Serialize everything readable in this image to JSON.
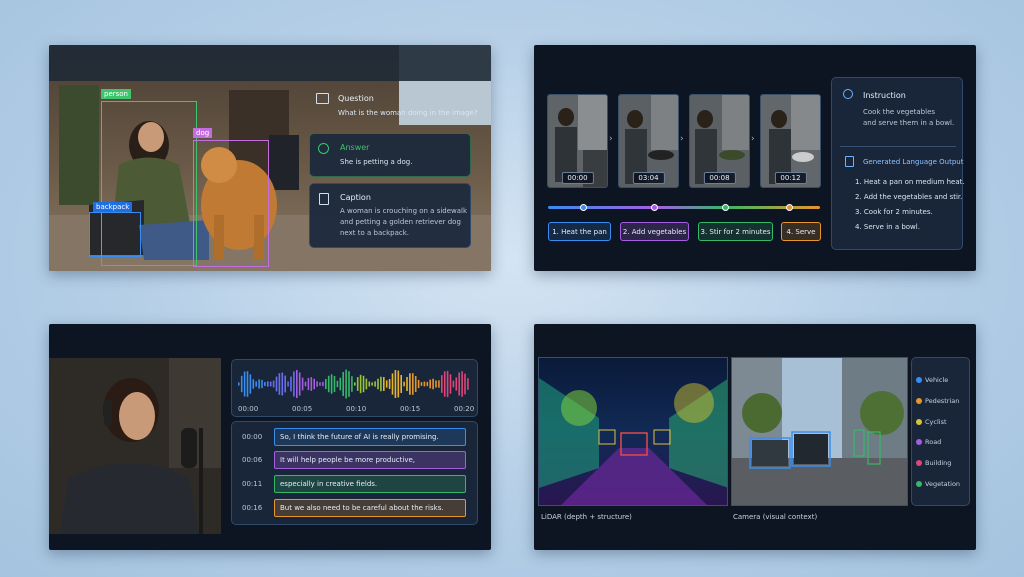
{
  "vqa": {
    "tags": {
      "person": "person",
      "dog": "dog",
      "backpack": "backpack"
    },
    "question": {
      "title": "Question",
      "text": "What is the woman doing in the image?",
      "icon": "image-icon"
    },
    "answer": {
      "title": "Answer",
      "text": "She is petting a dog.",
      "icon": "answer-icon"
    },
    "caption": {
      "title": "Caption",
      "text": "A woman is crouching on a sidewalk\nand petting a golden retriever dog\nnext to a backpack.",
      "icon": "document-icon"
    },
    "colors": {
      "person": "#3ec46d",
      "dog": "#c36ee0",
      "backpack": "#3a8df0",
      "answer": "#3ec46d"
    }
  },
  "video": {
    "timestamps": [
      "00:00",
      "03:04",
      "00:08",
      "00:12"
    ],
    "steps": [
      {
        "label": "1. Heat the pan",
        "color": "#3a8df0"
      },
      {
        "label": "2. Add vegetables",
        "color": "#a45ee0"
      },
      {
        "label": "3. Stir for 2 minutes",
        "color": "#35b86a"
      },
      {
        "label": "4. Serve",
        "color": "#e8952e"
      }
    ],
    "instruction": {
      "title": "Instruction",
      "text": "Cook the vegetables\nand serve them in a bowl."
    },
    "output": {
      "title": "Generated Language Output",
      "lines": [
        "1.  Heat a pan on medium heat.",
        "2.  Add the vegetables and stir.",
        "3.  Cook for 2 minutes.",
        "4.  Serve in a bowl."
      ]
    }
  },
  "audio": {
    "ticks": [
      "00:00",
      "00:05",
      "00:10",
      "00:15",
      "00:20"
    ],
    "transcript": [
      {
        "time": "00:00",
        "text": "So, I think the future of AI is really promising.",
        "color": "#3a8df0"
      },
      {
        "time": "00:06",
        "text": "It will help people be more productive,",
        "color": "#a45ee0"
      },
      {
        "time": "00:11",
        "text": "especially in creative fields.",
        "color": "#35b86a"
      },
      {
        "time": "00:16",
        "text": "But we also need to be careful about the risks.",
        "color": "#e8952e"
      }
    ]
  },
  "driving": {
    "lidar_label": "LiDAR (depth + structure)",
    "camera_label": "Camera (visual context)",
    "legend": [
      {
        "label": "Vehicle",
        "color": "#3a8df0"
      },
      {
        "label": "Pedestrian",
        "color": "#e8952e"
      },
      {
        "label": "Cyclist",
        "color": "#d8c43a"
      },
      {
        "label": "Road",
        "color": "#a45ee0"
      },
      {
        "label": "Building",
        "color": "#e0457a"
      },
      {
        "label": "Vegetation",
        "color": "#35b86a"
      }
    ]
  }
}
